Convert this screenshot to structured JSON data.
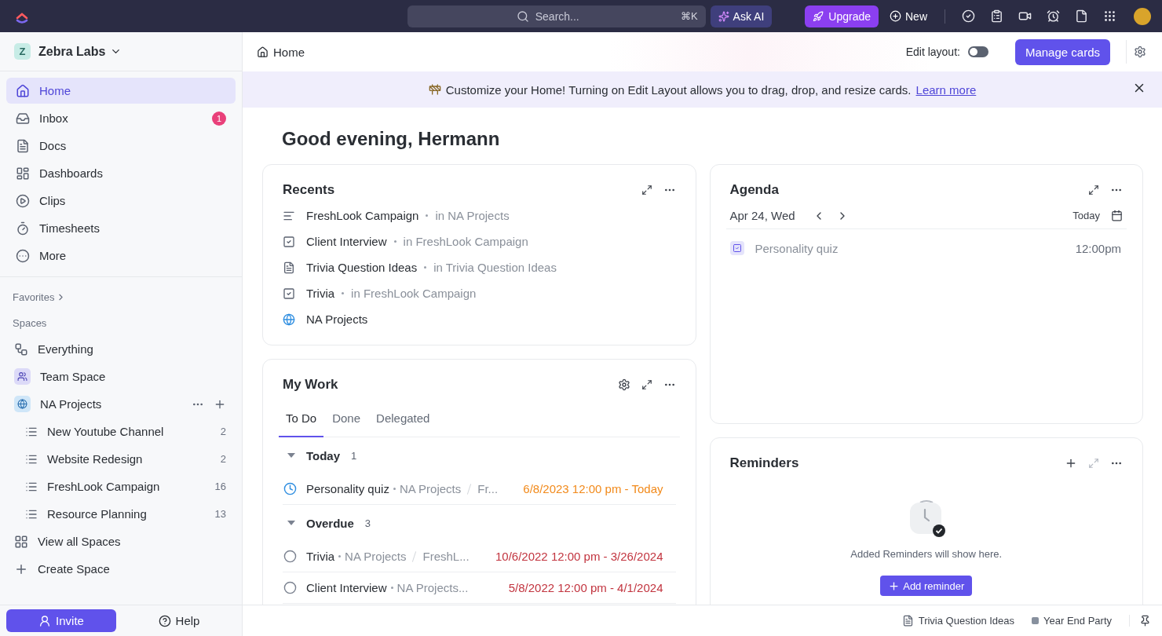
{
  "topbar": {
    "search": {
      "placeholder": "Search...",
      "shortcut": "⌘K"
    },
    "ask_ai": "Ask AI",
    "upgrade": "Upgrade",
    "new": "New"
  },
  "sidebar": {
    "workspace": {
      "initial": "Z",
      "name": "Zebra Labs"
    },
    "nav": [
      {
        "label": "Home",
        "selected": true
      },
      {
        "label": "Inbox",
        "selected": false,
        "badge": "1"
      },
      {
        "label": "Docs",
        "selected": false
      },
      {
        "label": "Dashboards",
        "selected": false
      },
      {
        "label": "Clips",
        "selected": false
      },
      {
        "label": "Timesheets",
        "selected": false
      },
      {
        "label": "More",
        "selected": false
      }
    ],
    "favorites": "Favorites",
    "spaces_heading": "Spaces",
    "spaces": [
      {
        "kind": "everything",
        "label": "Everything"
      },
      {
        "kind": "team",
        "label": "Team Space"
      },
      {
        "kind": "space",
        "label": "NA Projects",
        "children": [
          {
            "label": "New Youtube Channel",
            "count": "2"
          },
          {
            "label": "Website Redesign",
            "count": "2"
          },
          {
            "label": "FreshLook Campaign",
            "count": "16"
          },
          {
            "label": "Resource Planning",
            "count": "13"
          }
        ]
      },
      {
        "kind": "view_all",
        "label": "View all Spaces"
      },
      {
        "kind": "create",
        "label": "Create Space"
      }
    ],
    "invite": "Invite",
    "help": "Help"
  },
  "header": {
    "breadcrumb": "Home",
    "edit_layout": {
      "label": "Edit layout:",
      "on": false
    },
    "manage": "Manage cards"
  },
  "banner": {
    "text": "Customize your Home! Turning on Edit Layout allows you to drag, drop, and resize cards.",
    "link": "Learn more"
  },
  "greeting": "Good evening, Hermann",
  "recents": {
    "title": "Recents",
    "items": [
      {
        "kind": "list",
        "name": "FreshLook Campaign",
        "location": "in NA Projects"
      },
      {
        "kind": "task",
        "name": "Client Interview",
        "location": "in FreshLook Campaign"
      },
      {
        "kind": "doc",
        "name": "Trivia Question Ideas",
        "location": "in Trivia Question Ideas"
      },
      {
        "kind": "task",
        "name": "Trivia",
        "location": "in FreshLook Campaign"
      },
      {
        "kind": "space",
        "name": "NA Projects"
      }
    ]
  },
  "my_work": {
    "title": "My Work",
    "tabs": [
      {
        "label": "To Do",
        "selected": true
      },
      {
        "label": "Done",
        "selected": false
      },
      {
        "label": "Delegated",
        "selected": false
      }
    ],
    "groups": [
      {
        "label": "Today",
        "count": "1",
        "expanded": true,
        "tasks": [
          {
            "kind": "in_progress",
            "name": "Personality quiz",
            "path": [
              "NA Projects",
              "Fr..."
            ],
            "due": "6/8/2023 12:00 pm - Today",
            "overdue": false
          }
        ]
      },
      {
        "label": "Overdue",
        "count": "3",
        "expanded": true,
        "tasks": [
          {
            "kind": "todo",
            "name": "Trivia",
            "path": [
              "NA Projects",
              "FreshL..."
            ],
            "due": "10/6/2022 12:00 pm - 3/26/2024",
            "overdue": true
          },
          {
            "kind": "todo",
            "name": "Client Interview",
            "path": [
              "NA Projects..."
            ],
            "due": "5/8/2022 12:00 pm - 4/1/2024",
            "overdue": true
          }
        ]
      }
    ]
  },
  "agenda": {
    "title": "Agenda",
    "date": "Apr 24, Wed",
    "today": "Today",
    "items": [
      {
        "name": "Personality quiz",
        "time": "12:00pm"
      }
    ]
  },
  "reminders": {
    "title": "Reminders",
    "empty": "Added Reminders will show here.",
    "button": "Add reminder"
  },
  "bottom_bar": [
    {
      "kind": "doc",
      "label": "Trivia Question Ideas"
    },
    {
      "kind": "task",
      "label": "Year End Party"
    }
  ]
}
